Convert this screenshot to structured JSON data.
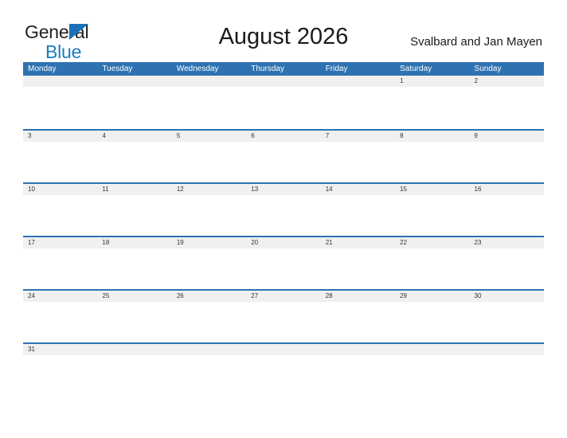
{
  "brand": {
    "name_part1": "General",
    "name_part2": "Blue",
    "logo_icon": "triangle-icon",
    "color_dark": "#231f20",
    "color_blue": "#1a7dc4",
    "color_triangle": "#1a6fb5"
  },
  "header": {
    "title": "August 2026",
    "region": "Svalbard and Jan Mayen"
  },
  "theme": {
    "header_blue": "#2e72b2",
    "date_band_gray": "#f0f0f0",
    "row_border_blue": "#2e72b2",
    "text_dark": "#1a1a1a"
  },
  "calendar": {
    "weekdays": [
      "Monday",
      "Tuesday",
      "Wednesday",
      "Thursday",
      "Friday",
      "Saturday",
      "Sunday"
    ],
    "weeks": [
      [
        "",
        "",
        "",
        "",
        "",
        "1",
        "2"
      ],
      [
        "3",
        "4",
        "5",
        "6",
        "7",
        "8",
        "9"
      ],
      [
        "10",
        "11",
        "12",
        "13",
        "14",
        "15",
        "16"
      ],
      [
        "17",
        "18",
        "19",
        "20",
        "21",
        "22",
        "23"
      ],
      [
        "24",
        "25",
        "26",
        "27",
        "28",
        "29",
        "30"
      ],
      [
        "31",
        "",
        "",
        "",
        "",
        "",
        ""
      ]
    ]
  }
}
